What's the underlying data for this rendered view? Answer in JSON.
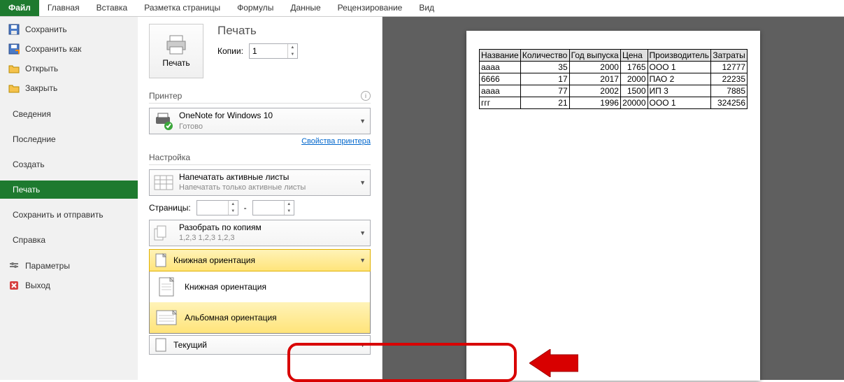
{
  "ribbon": {
    "tabs": [
      "Файл",
      "Главная",
      "Вставка",
      "Разметка страницы",
      "Формулы",
      "Данные",
      "Рецензирование",
      "Вид"
    ],
    "active": 0
  },
  "sidebar": {
    "items": [
      {
        "label": "Сохранить",
        "icon": "save"
      },
      {
        "label": "Сохранить как",
        "icon": "save-as"
      },
      {
        "label": "Открыть",
        "icon": "open"
      },
      {
        "label": "Закрыть",
        "icon": "close-file"
      }
    ],
    "plain": [
      "Сведения",
      "Последние",
      "Создать",
      "Печать",
      "Сохранить и отправить",
      "Справка"
    ],
    "bottom": [
      {
        "label": "Параметры",
        "icon": "options"
      },
      {
        "label": "Выход",
        "icon": "exit"
      }
    ],
    "active": "Печать"
  },
  "print": {
    "heading": "Печать",
    "button": "Печать",
    "copies_label": "Копии:",
    "copies_value": "1",
    "printer_heading": "Принтер",
    "printer_name": "OneNote for Windows 10",
    "printer_status": "Готово",
    "printer_props": "Свойства принтера",
    "settings_heading": "Настройка",
    "print_what": {
      "title": "Напечатать активные листы",
      "sub": "Напечатать только активные листы"
    },
    "pages_label": "Страницы:",
    "pages_from": "",
    "pages_sep": "-",
    "pages_to": "",
    "collate": {
      "title": "Разобрать по копиям",
      "sub": "1,2,3    1,2,3    1,2,3"
    },
    "orientation": {
      "title": "Книжная ориентация"
    },
    "orient_opts": [
      "Книжная ориентация",
      "Альбомная ориентация"
    ],
    "current": "Текущий"
  },
  "preview": {
    "headers": [
      "Название",
      "Количество",
      "Год выпуска",
      "Цена",
      "Производитель",
      "Затраты"
    ],
    "rows": [
      [
        "aaaa",
        "35",
        "2000",
        "1765",
        "ООО 1",
        "12777"
      ],
      [
        "6666",
        "17",
        "2017",
        "2000",
        "ПАО 2",
        "22235"
      ],
      [
        "aaaa",
        "77",
        "2002",
        "1500",
        "ИП 3",
        "7885"
      ],
      [
        "ггг",
        "21",
        "1996",
        "20000",
        "ООО 1",
        "324256"
      ]
    ]
  }
}
